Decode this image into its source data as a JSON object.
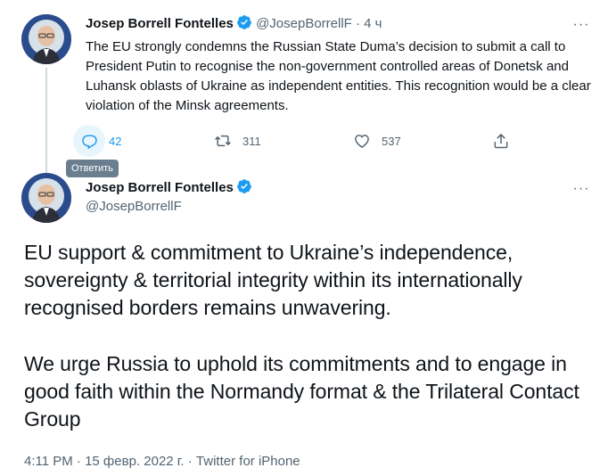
{
  "parent_tweet": {
    "author_name": "Josep Borrell Fontelles",
    "handle": "@JosepBorrellF",
    "separator": "·",
    "time": "4 ч",
    "text": "The EU strongly condemns the Russian State Duma’s decision to submit a call to President Putin to recognise the non-government controlled areas of Donetsk and Luhansk oblasts of Ukraine as independent entities. This recognition would be a clear violation of the Minsk agreements.",
    "more": "···",
    "actions": {
      "reply_count": "42",
      "retweet_count": "311",
      "like_count": "537"
    },
    "tooltip": "Ответить"
  },
  "main_tweet": {
    "author_name": "Josep Borrell Fontelles",
    "handle": "@JosepBorrellF",
    "more": "···",
    "paragraphs": [
      "EU support & commitment to Ukraine’s independence, sovereignty & territorial integrity within its internationally recognised borders remains unwavering.",
      "We urge Russia to uphold its commitments and to engage in good faith within the Normandy format & the Trilateral Contact Group"
    ],
    "meta": "4:11 PM · 15 февр. 2022 г. · Twitter for iPhone"
  },
  "colors": {
    "accent": "#1d9bf0",
    "secondary_text": "#536471",
    "thread_line": "#cfd9de",
    "tooltip_bg": "#5b7083"
  },
  "icons": [
    "verified-badge-icon",
    "reply-icon",
    "retweet-icon",
    "like-icon",
    "share-icon",
    "more-icon"
  ]
}
